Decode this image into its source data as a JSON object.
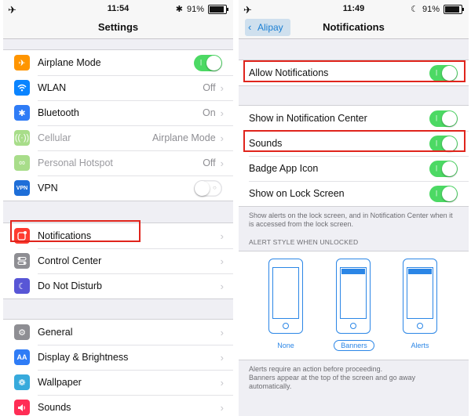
{
  "left": {
    "status": {
      "signal": "✈",
      "time": "11:54",
      "bluetooth": "✱",
      "battery": "91%",
      "battery_level": 0.91
    },
    "title": "Settings",
    "groups": [
      [
        {
          "label": "Airplane Mode",
          "icon": "airplane-icon",
          "type": "toggle",
          "on": true
        },
        {
          "label": "WLAN",
          "icon": "wifi-icon",
          "value": "Off"
        },
        {
          "label": "Bluetooth",
          "icon": "bluetooth-icon",
          "value": "On"
        },
        {
          "label": "Cellular",
          "icon": "cellular-icon",
          "value": "Airplane Mode",
          "disabled": true
        },
        {
          "label": "Personal Hotspot",
          "icon": "hotspot-icon",
          "value": "Off",
          "disabled": true
        },
        {
          "label": "VPN",
          "icon": "vpn-icon",
          "icon_text": "VPN",
          "type": "toggle",
          "on": false
        }
      ],
      [
        {
          "label": "Notifications",
          "icon": "notifications-icon",
          "highlighted": true
        },
        {
          "label": "Control Center",
          "icon": "control-center-icon"
        },
        {
          "label": "Do Not Disturb",
          "icon": "moon-icon"
        }
      ],
      [
        {
          "label": "General",
          "icon": "gear-icon"
        },
        {
          "label": "Display & Brightness",
          "icon": "display-icon",
          "icon_text": "AA"
        },
        {
          "label": "Wallpaper",
          "icon": "wallpaper-icon"
        },
        {
          "label": "Sounds",
          "icon": "speaker-icon"
        }
      ]
    ]
  },
  "right": {
    "status": {
      "signal": "✈",
      "time": "11:49",
      "moon": "☾",
      "battery": "91%",
      "battery_level": 0.91
    },
    "back_label": "Alipay",
    "title": "Notifications",
    "allow": {
      "label": "Allow Notifications",
      "on": true
    },
    "options": [
      {
        "label": "Show in Notification Center",
        "on": true
      },
      {
        "label": "Sounds",
        "on": true
      },
      {
        "label": "Badge App Icon",
        "on": true
      },
      {
        "label": "Show on Lock Screen",
        "on": true
      }
    ],
    "lock_footnote": "Show alerts on the lock screen, and in Notification Center when it is accessed from the lock screen.",
    "alert_header": "ALERT STYLE WHEN UNLOCKED",
    "alert_styles": [
      {
        "label": "None",
        "selected": false
      },
      {
        "label": "Banners",
        "selected": true
      },
      {
        "label": "Alerts",
        "selected": false
      }
    ],
    "alert_footnote": "Alerts require an action before proceeding.\nBanners appear at the top of the screen and go away automatically."
  },
  "colors": {
    "toggle_on": "#4cd964",
    "highlight": "#e0241c",
    "accent": "#2b86e6"
  }
}
